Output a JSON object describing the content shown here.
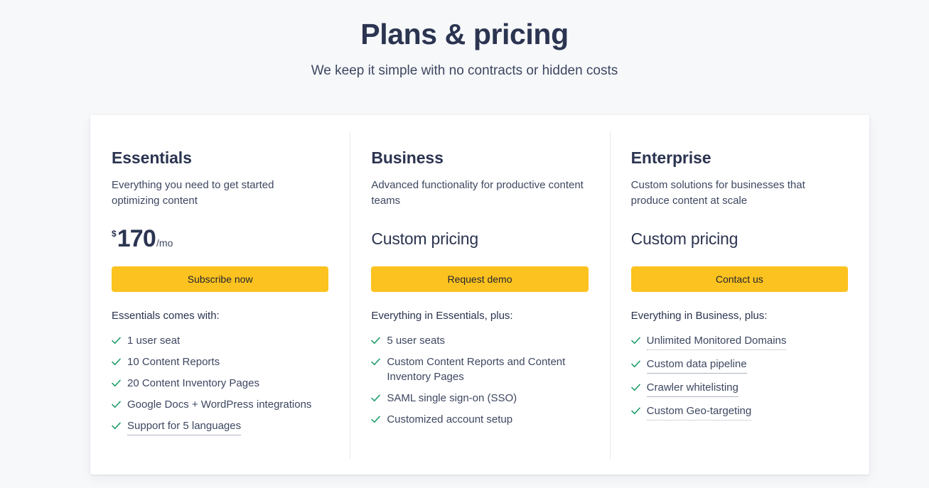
{
  "header": {
    "title": "Plans & pricing",
    "subtitle": "We keep it simple with no contracts or hidden costs"
  },
  "colors": {
    "page_background": "#f7f8fa",
    "card_background": "#ffffff",
    "heading": "#2b3450",
    "body_text": "#3d4760",
    "cta_background": "#fcc21f",
    "cta_text": "#1f2430",
    "check_green": "#21a06b",
    "divider": "#e7e9ee",
    "underline": "#aeb4c2"
  },
  "plans": [
    {
      "name": "Essentials",
      "description": "Everything you need to get started optimizing content",
      "price": {
        "type": "amount",
        "currency": "$",
        "amount": "170",
        "period": "/mo"
      },
      "cta": "Subscribe now",
      "features_heading": "Essentials comes with:",
      "features": [
        {
          "label": "1 user seat",
          "underline": "none"
        },
        {
          "label": "10 Content Reports",
          "underline": "none"
        },
        {
          "label": "20 Content Inventory Pages",
          "underline": "none"
        },
        {
          "label": "Google Docs + WordPress integrations",
          "underline": "none"
        },
        {
          "label": "Support for 5 languages",
          "underline": "solid"
        }
      ]
    },
    {
      "name": "Business",
      "description": "Advanced functionality for productive content teams",
      "price": {
        "type": "custom",
        "custom_label": "Custom pricing"
      },
      "cta": "Request demo",
      "features_heading": "Everything in Essentials, plus:",
      "features": [
        {
          "label": "5 user seats",
          "underline": "none"
        },
        {
          "label": "Custom Content Reports and Content Inventory Pages",
          "underline": "none"
        },
        {
          "label": "SAML single sign-on (SSO)",
          "underline": "none"
        },
        {
          "label": "Customized account setup",
          "underline": "none"
        }
      ]
    },
    {
      "name": "Enterprise",
      "description": "Custom solutions for businesses that produce content at scale",
      "price": {
        "type": "custom",
        "custom_label": "Custom pricing"
      },
      "cta": "Contact us",
      "features_heading": "Everything in Business, plus:",
      "features": [
        {
          "label": "Unlimited Monitored Domains",
          "underline": "dotted"
        },
        {
          "label": "Custom data pipeline",
          "underline": "solid"
        },
        {
          "label": "Crawler whitelisting",
          "underline": "solid"
        },
        {
          "label": "Custom Geo-targeting",
          "underline": "dotted"
        }
      ]
    }
  ],
  "icons": {
    "check": "check-icon"
  }
}
